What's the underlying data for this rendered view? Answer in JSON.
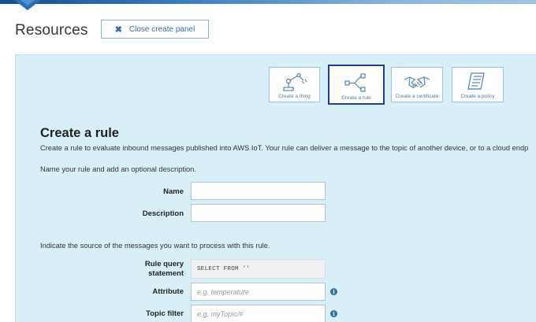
{
  "header": {
    "title": "Resources",
    "close_button": {
      "icon": "close-x-icon",
      "label": "Close create panel"
    }
  },
  "tiles": [
    {
      "label": "Create a thing",
      "icon": "robot-arm-icon"
    },
    {
      "label": "Create a rule",
      "icon": "rule-branch-icon",
      "active": true
    },
    {
      "label": "Create a certificate",
      "icon": "handshake-icon"
    },
    {
      "label": "Create a policy",
      "icon": "policy-document-icon"
    }
  ],
  "form": {
    "heading": "Create a rule",
    "intro": "Create a rule to evaluate inbound messages published into AWS IoT. Your rule can deliver a message to the topic of another device, or to a cloud endp",
    "name_prompt": "Name your rule and add an optional description.",
    "name_label": "Name",
    "name_value": "",
    "description_label": "Description",
    "description_value": "",
    "source_prompt": "Indicate the source of the messages you want to process with this rule.",
    "query_label_line1": "Rule query",
    "query_label_line2": "statement",
    "query_value": "SELECT  FROM ''",
    "attribute_label": "Attribute",
    "attribute_placeholder": "e.g. temperature",
    "topic_label": "Topic filter",
    "topic_placeholder": "e.g. myTopic/#",
    "info_glyph": "i"
  },
  "colors": {
    "panel_bg": "#d9eff7",
    "accent": "#3f6f99",
    "active_border": "#1f3f9a",
    "info_icon": "#2f6fa8"
  }
}
